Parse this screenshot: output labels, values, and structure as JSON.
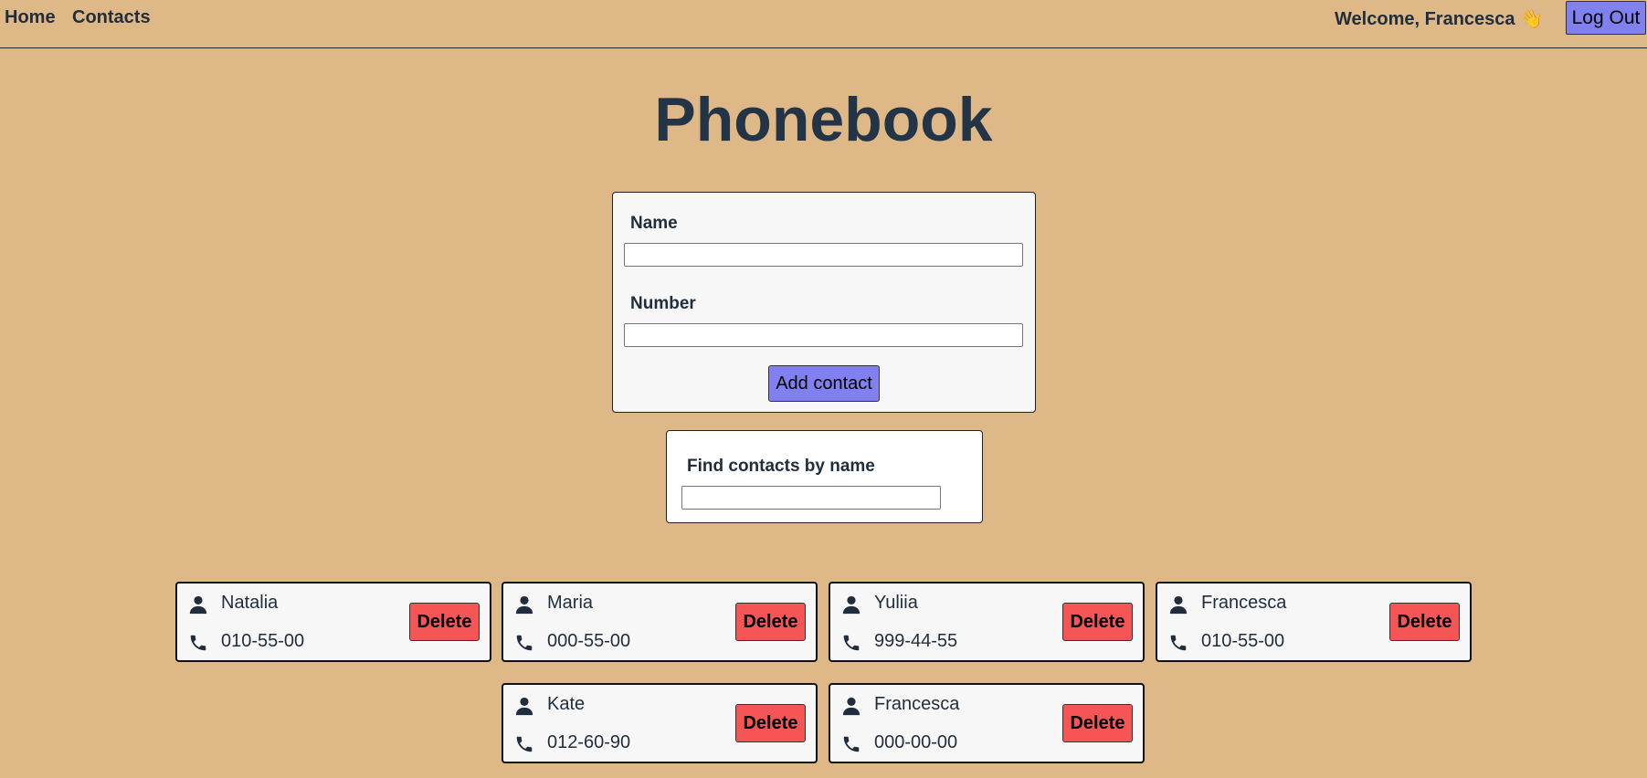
{
  "nav": {
    "home": "Home",
    "contacts": "Contacts"
  },
  "user": {
    "welcome": "Welcome, Francesca 👋",
    "logout": "Log Out"
  },
  "page": {
    "title": "Phonebook"
  },
  "form": {
    "name_label": "Name",
    "number_label": "Number",
    "name_value": "",
    "number_value": "",
    "submit": "Add contact"
  },
  "filter": {
    "label": "Find contacts by name",
    "value": ""
  },
  "contacts": [
    {
      "name": "Natalia",
      "number": "010-55-00",
      "delete": "Delete"
    },
    {
      "name": "Maria",
      "number": "000-55-00",
      "delete": "Delete"
    },
    {
      "name": "Yuliia",
      "number": "999-44-55",
      "delete": "Delete"
    },
    {
      "name": "Francesca",
      "number": "010-55-00",
      "delete": "Delete"
    },
    {
      "name": "Kate",
      "number": "012-60-90",
      "delete": "Delete"
    },
    {
      "name": "Francesca",
      "number": "000-00-00",
      "delete": "Delete"
    }
  ],
  "icons": {
    "person": "person-icon",
    "phone": "phone-icon"
  },
  "colors": {
    "background": "#deb887",
    "primary_button": "#8080f0",
    "danger_button": "#f55555",
    "text": "#1f2d3d"
  }
}
